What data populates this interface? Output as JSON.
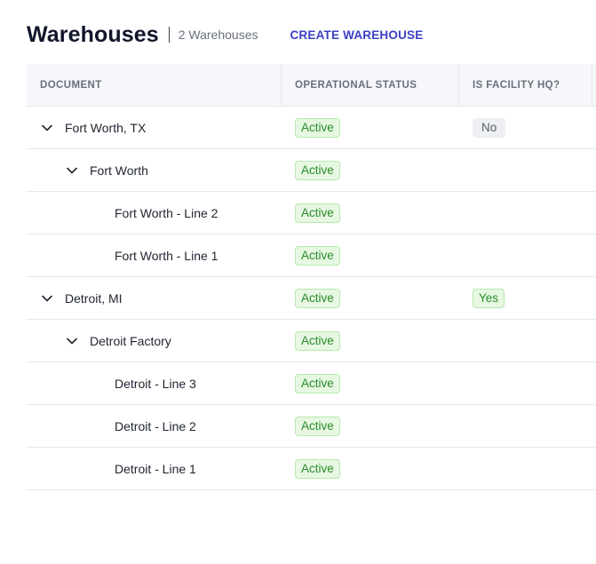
{
  "header": {
    "title": "Warehouses",
    "count": "2 Warehouses",
    "create_label": "CREATE WAREHOUSE"
  },
  "table": {
    "columns": [
      "DOCUMENT",
      "OPERATIONAL STATUS",
      "IS FACILITY HQ?"
    ],
    "rows": [
      {
        "name": "Fort Worth, TX",
        "status": "Active",
        "hq": "No"
      },
      {
        "name": "Fort Worth",
        "status": "Active",
        "hq": ""
      },
      {
        "name": "Fort Worth - Line 2",
        "status": "Active",
        "hq": ""
      },
      {
        "name": "Fort Worth - Line 1",
        "status": "Active",
        "hq": ""
      },
      {
        "name": "Detroit, MI",
        "status": "Active",
        "hq": "Yes"
      },
      {
        "name": "Detroit Factory",
        "status": "Active",
        "hq": ""
      },
      {
        "name": "Detroit - Line 3",
        "status": "Active",
        "hq": ""
      },
      {
        "name": "Detroit - Line 2",
        "status": "Active",
        "hq": ""
      },
      {
        "name": "Detroit - Line 1",
        "status": "Active",
        "hq": ""
      }
    ]
  },
  "icons": {
    "expand": "chevron-down-icon"
  },
  "colors": {
    "accent": "#3b3fc4",
    "active_bg": "#e6f8e2",
    "active_text": "#2b8a2b",
    "neutral_bg": "#eff0f3"
  }
}
